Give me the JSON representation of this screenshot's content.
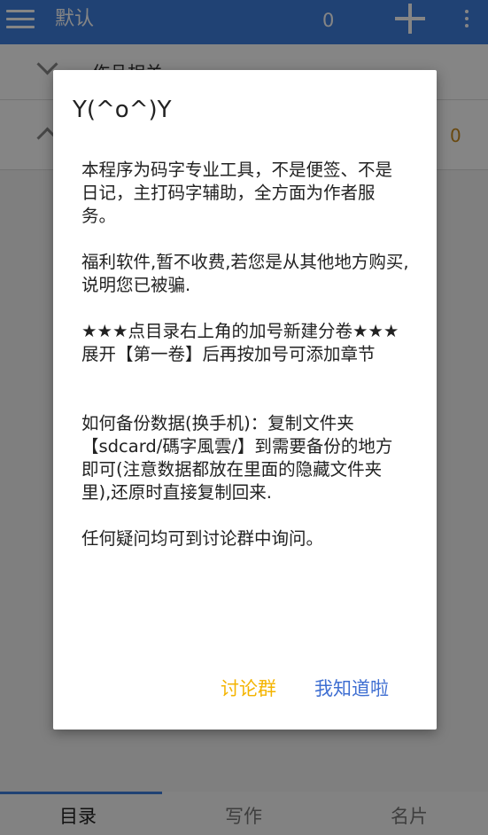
{
  "appbar": {
    "title": "默认",
    "count": "0",
    "menu_icon": "hamburger-icon",
    "add_icon": "plus-icon",
    "more_icon": "more-vert-icon"
  },
  "list": {
    "row1_label": "作品相关",
    "row2_count": "0"
  },
  "tabs": [
    "目录",
    "写作",
    "名片"
  ],
  "dialog": {
    "title": "Y(^o^)Y",
    "paragraphs": [
      "本程序为码字专业工具，不是便签、不是日记，主打码字辅助，全方面为作者服务。",
      "福利软件,暂不收费,若您是从其他地方购买,说明您已被骗.",
      "★★★点目录右上角的加号新建分卷★★★\n展开【第一卷】后再按加号可添加章节",
      "如何备份数据(换手机)：复制文件夹【sdcard/碼字風雲/】到需要备份的地方即可(注意数据都放在里面的隐藏文件夹里),还原时直接复制回来.",
      "任何疑问均可到讨论群中询问。"
    ],
    "buttons": {
      "chat": "讨论群",
      "ok": "我知道啦"
    }
  },
  "colors": {
    "appbar": "#3f7fde",
    "ok_button": "#3f6fd2",
    "chat_button": "#f4b400",
    "count_accent": "#c98a1b"
  }
}
